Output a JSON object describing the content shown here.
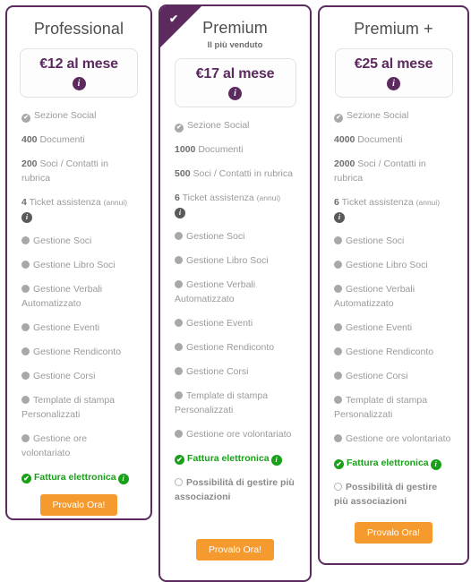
{
  "theme": {
    "accent_purple": "#5c2a5e",
    "cta_orange": "#f59a2e",
    "green": "#18a018",
    "muted_gray": "#9a9a9a",
    "card_bg": "#ffffff",
    "page_bg": "#ffffff"
  },
  "icons": {
    "info": "i",
    "check": "✔",
    "check_small": "✔"
  },
  "plans": [
    {
      "id": "professional",
      "title": "Professional",
      "subtitle": "",
      "badge": false,
      "price": "€12 al mese",
      "price_info_icon": "info-icon",
      "features": [
        {
          "icon": "check-circle-gray",
          "num": "",
          "text": "Sezione Social",
          "note": "",
          "info": false,
          "style": "muted"
        },
        {
          "icon": "none",
          "num": "400",
          "text": "Documenti",
          "note": "",
          "info": false,
          "style": "muted"
        },
        {
          "icon": "none",
          "num": "200",
          "text": "Soci / Contatti in rubrica",
          "note": "",
          "info": false,
          "style": "muted"
        },
        {
          "icon": "none",
          "num": "4",
          "text": "Ticket assistenza",
          "note": "(annui)",
          "info": true,
          "style": "muted"
        },
        {
          "icon": "dot-gray",
          "num": "",
          "text": "Gestione Soci",
          "note": "",
          "info": false,
          "style": "muted"
        },
        {
          "icon": "dot-gray",
          "num": "",
          "text": "Gestione Libro Soci",
          "note": "",
          "info": false,
          "style": "muted"
        },
        {
          "icon": "dot-gray",
          "num": "",
          "text": "Gestione Verbali Automatizzato",
          "note": "",
          "info": false,
          "style": "muted"
        },
        {
          "icon": "dot-gray",
          "num": "",
          "text": "Gestione Eventi",
          "note": "",
          "info": false,
          "style": "muted"
        },
        {
          "icon": "dot-gray",
          "num": "",
          "text": "Gestione Rendiconto",
          "note": "",
          "info": false,
          "style": "muted"
        },
        {
          "icon": "dot-gray",
          "num": "",
          "text": "Gestione Corsi",
          "note": "",
          "info": false,
          "style": "muted"
        },
        {
          "icon": "dot-gray",
          "num": "",
          "text": "Template di stampa Personalizzati",
          "note": "",
          "info": false,
          "style": "muted"
        },
        {
          "icon": "dot-gray",
          "num": "",
          "text": "Gestione ore volontariato",
          "note": "",
          "info": false,
          "style": "muted"
        },
        {
          "icon": "check-circle-green",
          "num": "",
          "text": "Fattura elettronica",
          "note": "",
          "info": true,
          "style": "green"
        }
      ],
      "cta": "Provalo Ora!"
    },
    {
      "id": "premium",
      "title": "Premium",
      "subtitle": "Il più venduto",
      "badge": true,
      "price": "€17 al mese",
      "price_info_icon": "info-icon",
      "features": [
        {
          "icon": "check-circle-gray",
          "num": "",
          "text": "Sezione Social",
          "note": "",
          "info": false,
          "style": "muted"
        },
        {
          "icon": "none",
          "num": "1000",
          "text": "Documenti",
          "note": "",
          "info": false,
          "style": "muted"
        },
        {
          "icon": "none",
          "num": "500",
          "text": "Soci / Contatti in rubrica",
          "note": "",
          "info": false,
          "style": "muted"
        },
        {
          "icon": "none",
          "num": "6",
          "text": "Ticket assistenza",
          "note": "(annui)",
          "info": true,
          "style": "muted"
        },
        {
          "icon": "dot-gray",
          "num": "",
          "text": "Gestione Soci",
          "note": "",
          "info": false,
          "style": "muted"
        },
        {
          "icon": "dot-gray",
          "num": "",
          "text": "Gestione Libro Soci",
          "note": "",
          "info": false,
          "style": "muted"
        },
        {
          "icon": "dot-gray",
          "num": "",
          "text": "Gestione Verbali Automatizzato",
          "note": "",
          "info": false,
          "style": "muted"
        },
        {
          "icon": "dot-gray",
          "num": "",
          "text": "Gestione Eventi",
          "note": "",
          "info": false,
          "style": "muted"
        },
        {
          "icon": "dot-gray",
          "num": "",
          "text": "Gestione Rendiconto",
          "note": "",
          "info": false,
          "style": "muted"
        },
        {
          "icon": "dot-gray",
          "num": "",
          "text": "Gestione Corsi",
          "note": "",
          "info": false,
          "style": "muted"
        },
        {
          "icon": "dot-gray",
          "num": "",
          "text": "Template di stampa Personalizzati",
          "note": "",
          "info": false,
          "style": "muted"
        },
        {
          "icon": "dot-gray",
          "num": "",
          "text": "Gestione ore volontariato",
          "note": "",
          "info": false,
          "style": "muted"
        },
        {
          "icon": "check-circle-green",
          "num": "",
          "text": "Fattura elettronica",
          "note": "",
          "info": true,
          "style": "green"
        },
        {
          "icon": "circle-empty",
          "num": "",
          "text": "Possibilità di gestire più associazioni",
          "note": "",
          "info": false,
          "style": "bold"
        }
      ],
      "cta": "Provalo Ora!"
    },
    {
      "id": "premium-plus",
      "title": "Premium +",
      "subtitle": "",
      "badge": false,
      "price": "€25 al mese",
      "price_info_icon": "info-icon",
      "features": [
        {
          "icon": "check-circle-gray",
          "num": "",
          "text": "Sezione Social",
          "note": "",
          "info": false,
          "style": "muted"
        },
        {
          "icon": "none",
          "num": "4000",
          "text": "Documenti",
          "note": "",
          "info": false,
          "style": "muted"
        },
        {
          "icon": "none",
          "num": "2000",
          "text": "Soci / Contatti in rubrica",
          "note": "",
          "info": false,
          "style": "muted"
        },
        {
          "icon": "none",
          "num": "6",
          "text": "Ticket assistenza",
          "note": "(annui)",
          "info": true,
          "style": "muted"
        },
        {
          "icon": "dot-gray",
          "num": "",
          "text": "Gestione Soci",
          "note": "",
          "info": false,
          "style": "muted"
        },
        {
          "icon": "dot-gray",
          "num": "",
          "text": "Gestione Libro Soci",
          "note": "",
          "info": false,
          "style": "muted"
        },
        {
          "icon": "dot-gray",
          "num": "",
          "text": "Gestione Verbali Automatizzato",
          "note": "",
          "info": false,
          "style": "muted"
        },
        {
          "icon": "dot-gray",
          "num": "",
          "text": "Gestione Eventi",
          "note": "",
          "info": false,
          "style": "muted"
        },
        {
          "icon": "dot-gray",
          "num": "",
          "text": "Gestione Rendiconto",
          "note": "",
          "info": false,
          "style": "muted"
        },
        {
          "icon": "dot-gray",
          "num": "",
          "text": "Gestione Corsi",
          "note": "",
          "info": false,
          "style": "muted"
        },
        {
          "icon": "dot-gray",
          "num": "",
          "text": "Template di stampa Personalizzati",
          "note": "",
          "info": false,
          "style": "muted"
        },
        {
          "icon": "dot-gray",
          "num": "",
          "text": "Gestione ore volontariato",
          "note": "",
          "info": false,
          "style": "muted"
        },
        {
          "icon": "check-circle-green",
          "num": "",
          "text": "Fattura elettronica",
          "note": "",
          "info": true,
          "style": "green"
        },
        {
          "icon": "circle-empty",
          "num": "",
          "text": "Possibilità di gestire più associazioni",
          "note": "",
          "info": false,
          "style": "bold"
        }
      ],
      "cta": "Provalo Ora!"
    }
  ]
}
